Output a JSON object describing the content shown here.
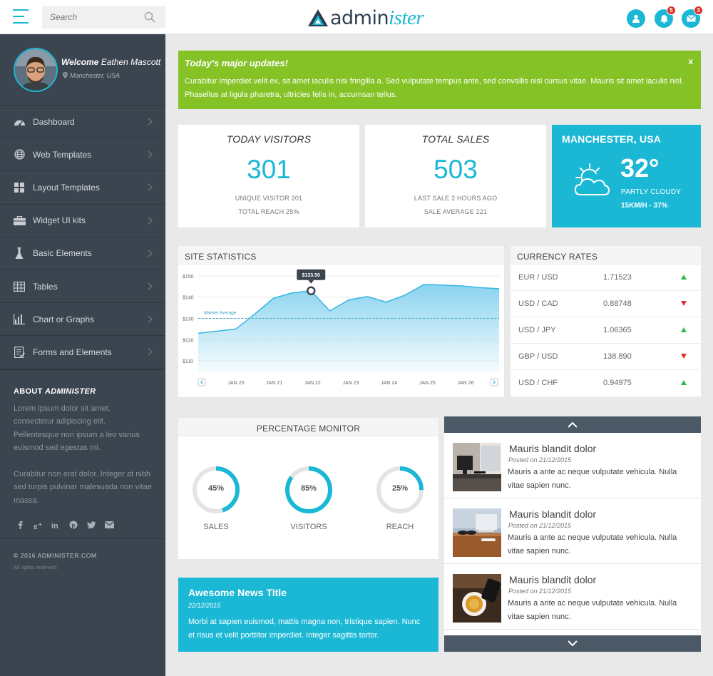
{
  "topbar": {
    "search_placeholder": "Search",
    "logo_plain": "admin",
    "logo_accent": "ister",
    "notifications_count": "5",
    "messages_count": "3"
  },
  "sidebar": {
    "welcome_prefix": "Welcome",
    "user_name": "Eathen Mascott",
    "location": "Manchester, USA",
    "items": [
      {
        "label": "Dashboard",
        "icon": "dashboard-icon"
      },
      {
        "label": "Web Templates",
        "icon": "globe-icon"
      },
      {
        "label": "Layout Templates",
        "icon": "grid-icon"
      },
      {
        "label": "Widget UI kits",
        "icon": "briefcase-icon"
      },
      {
        "label": "Basic Elements",
        "icon": "flask-icon"
      },
      {
        "label": "Tables",
        "icon": "table-icon"
      },
      {
        "label": "Chart or Graphs",
        "icon": "bar-chart-icon"
      },
      {
        "label": "Forms and Elements",
        "icon": "form-icon"
      }
    ],
    "about_title_prefix": "ABOUT",
    "about_title_brand": "ADMINISTER",
    "about_p1": "Lorem ipsum dolor sit amet, consectetur adipiscing elit. Pellentesque non ipsum a leo varius euismod sed egestas mi.",
    "about_p2": "Curabitur non erat dolor. Integer at nibh sed turpis pulvinar malesuada non vitae massa.",
    "copyright": "© 2016 ADMINISTER.COM",
    "rights": "All rights reserved."
  },
  "alert": {
    "title": "Today's major updates!",
    "body": "Curabitur imperdiet velit ex, sit amet iaculis nisi fringilla a. Sed vulputate tempus ante, sed convallis nisl cursus vitae. Mauris sit amet iaculis nisl. Phasellus at ligula pharetra, ultricies felis in, accumsan tellus.",
    "close": "x"
  },
  "stats": {
    "visitors": {
      "title": "TODAY VISITORS",
      "value": "301",
      "line1": "UNIQUE VISITOR 201",
      "line2": "TOTAL REACH 25%"
    },
    "sales": {
      "title": "TOTAL SALES",
      "value": "503",
      "line1": "LAST SALE 2 HOURS AGO",
      "line2": "SALE AVERAGE 221"
    }
  },
  "weather": {
    "city": "MANCHESTER, USA",
    "temp": "32°",
    "condition": "PARTLY CLOUDY",
    "wind": "15KM/H - 37%"
  },
  "site_stats": {
    "title": "SITE STATISTICS"
  },
  "chart_data": {
    "type": "area",
    "title": "SITE STATISTICS",
    "categories": [
      "JAN 20",
      "JAN 21",
      "JAN 22",
      "JAN 23",
      "JAN 24",
      "JAN 25",
      "JAN 26"
    ],
    "x": [
      0,
      1,
      2,
      3,
      4,
      5,
      6,
      7,
      8,
      9,
      10,
      11,
      12,
      13,
      14,
      15,
      16
    ],
    "values": [
      123,
      124,
      125,
      132,
      139.5,
      142,
      143,
      133.5,
      138.7,
      140.3,
      137.7,
      141,
      146,
      145.7,
      145.3,
      144.5,
      144
    ],
    "series": [
      {
        "name": "",
        "values": [
          123,
          124,
          125,
          132,
          139.5,
          142,
          143,
          133.5,
          138.7,
          140.3,
          137.7,
          141,
          146,
          145.7,
          145.3,
          144.5,
          144
        ]
      }
    ],
    "yticks": [
      "$150",
      "$140",
      "$130",
      "$120",
      "$110"
    ],
    "ylim": [
      105,
      152
    ],
    "reference_line": {
      "label": "Market Average",
      "value": 130
    },
    "tooltip": {
      "label": "$133.50"
    },
    "grid": true,
    "colors": {
      "fill": "#8ad3ef",
      "line": "#35b5e5"
    }
  },
  "currency": {
    "title": "CURRENCY RATES",
    "rows": [
      {
        "pair": "EUR / USD",
        "rate": "1.71523",
        "dir": "up"
      },
      {
        "pair": "USD / CAD",
        "rate": "0.88748",
        "dir": "down"
      },
      {
        "pair": "USD / JPY",
        "rate": "1.06365",
        "dir": "up"
      },
      {
        "pair": "GBP / USD",
        "rate": "138.890",
        "dir": "down"
      },
      {
        "pair": "USD / CHF",
        "rate": "0.94975",
        "dir": "up"
      }
    ],
    "colors": {
      "up": "#2db84b",
      "down": "#d9322b"
    }
  },
  "percentage": {
    "title": "PERCENTAGE MONITOR",
    "rings": [
      {
        "label": "SALES",
        "value": "45%",
        "fraction": 0.45
      },
      {
        "label": "VISITORS",
        "value": "85%",
        "fraction": 0.85
      },
      {
        "label": "REACH",
        "value": "25%",
        "fraction": 0.25
      }
    ]
  },
  "news": {
    "title": "Awesome News Title",
    "date": "22/12/2015",
    "body": "Morbi at sapien euismod, mattis magna non, tristique sapien. Nunc et risus et velit porttitor imperdiet. Integer sagittis tortor."
  },
  "feed": {
    "items": [
      {
        "title": "Mauris blandit dolor",
        "posted": "Posted on 21/12/2015",
        "body": "Mauris a ante ac neque vulputate vehicula. Nulla vitae sapien nunc."
      },
      {
        "title": "Mauris blandit dolor",
        "posted": "Posted on 21/12/2015",
        "body": "Mauris a ante ac neque vulputate vehicula. Nulla vitae sapien nunc."
      },
      {
        "title": "Mauris blandit dolor",
        "posted": "Posted on 21/12/2015",
        "body": "Mauris a ante ac neque vulputate vehicula. Nulla vitae sapien nunc."
      }
    ]
  },
  "colors": {
    "accent": "#1bb8d6",
    "sidebar": "#3b4550",
    "alert": "#84c225"
  }
}
